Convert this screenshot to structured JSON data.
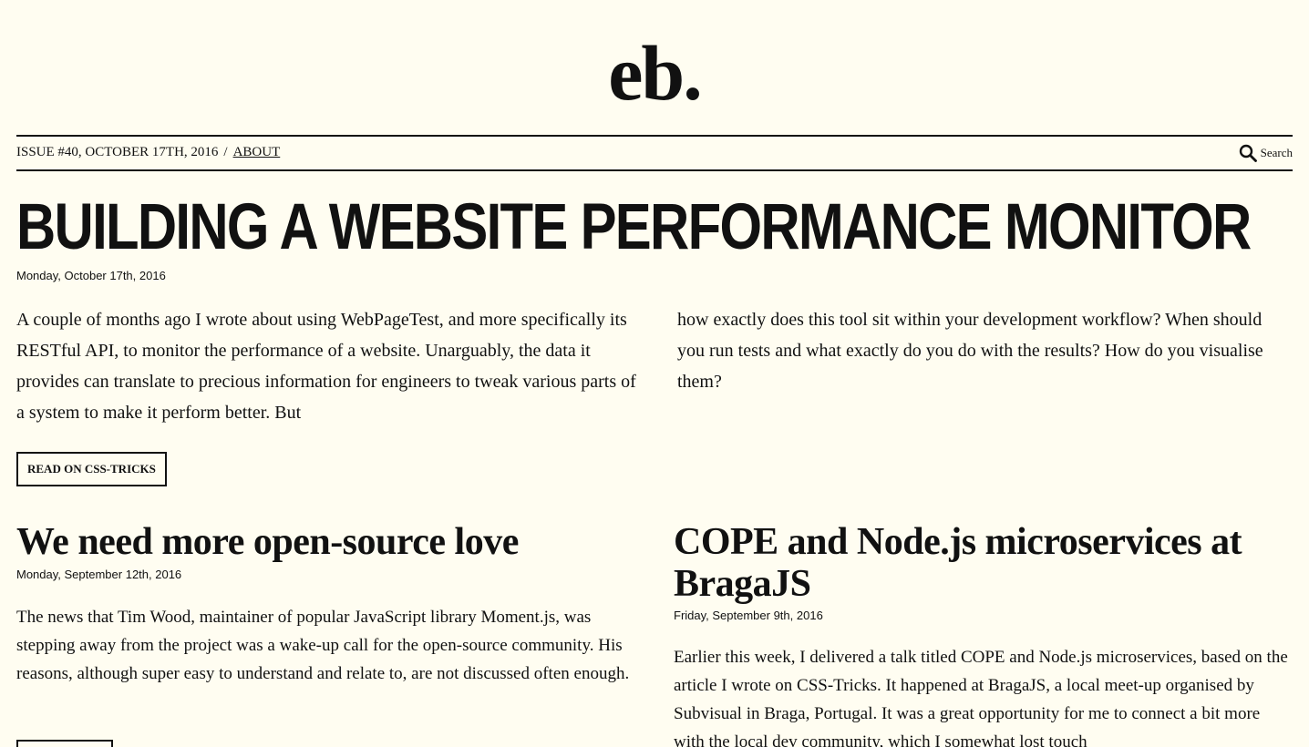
{
  "site": {
    "logo": "eb."
  },
  "topbar": {
    "issue": "ISSUE #40, OCTOBER 17TH, 2016",
    "separator": "/",
    "about_link": "ABOUT",
    "search_label": "Search",
    "search_icon": "search-icon"
  },
  "featured": {
    "title": "BUILDING A WEBSITE PERFORMANCE MONITOR",
    "date": "Monday, October 17th, 2016",
    "paragraph_col1": "A couple of months ago I wrote about using WebPageTest, and more specifically its RESTful API, to monitor the performance of a website. Unarguably, the data it provides can translate to precious information for engineers to tweak various parts of a system to make it perform better. But",
    "paragraph_col2": "how exactly does this tool sit within your development workflow? When should you run tests and what exactly do you do with the results? How do you visualise them?",
    "button_label": "READ ON CSS-TRICKS"
  },
  "posts": [
    {
      "title": "We need more open-source love",
      "date": "Monday, September 12th, 2016",
      "excerpt": "The news that Tim Wood, maintainer of popular JavaScript library Moment.js, was stepping away from the project was a wake-up call for the open-source community. His reasons, although super easy to understand and relate to, are not discussed often enough."
    },
    {
      "title": "COPE and Node.js microservices at BragaJS",
      "date": "Friday, September 9th, 2016",
      "excerpt": "Earlier this week, I delivered a talk titled COPE and Node.js microservices, based on the article I wrote on CSS-Tricks. It happened at BragaJS, a local meet-up organised by Subvisual in Braga, Portugal. It was a great opportunity for me to connect a bit more with the local dev community, which I somewhat lost touch"
    }
  ]
}
